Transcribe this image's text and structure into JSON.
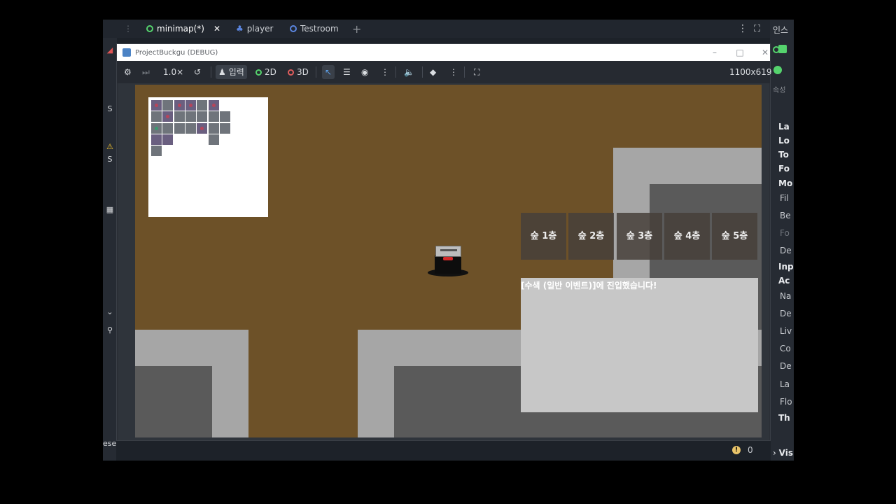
{
  "editor_tabs": [
    {
      "label": "minimap(*)",
      "icon": "scene-ring-icon",
      "close": "✕"
    },
    {
      "label": "player",
      "icon": "player-node-icon"
    },
    {
      "label": "Testroom",
      "icon": "scene-ring-icon"
    }
  ],
  "add_tab_label": "+",
  "right_panel": {
    "top_label": "인스",
    "sub_label": "속성",
    "items": [
      "La",
      "Lo",
      "To",
      "Fo",
      "Mo",
      "Fil",
      "Be",
      "Fo",
      "De",
      "Inp",
      "Ac",
      "Na",
      "De",
      "Liv",
      "Co",
      "De",
      "La",
      "Flo",
      "Th"
    ],
    "bottom_label": "Vis"
  },
  "left_strip": {
    "bottom_label": "ese"
  },
  "window": {
    "title": "ProjectBuckgu (DEBUG)",
    "minimize": "–",
    "maximize": "□",
    "close": "✕"
  },
  "toolbar": {
    "zoom": "1.0×",
    "input_label": "입력",
    "mode_2d": "2D",
    "mode_3d": "3D",
    "resolution": "1100x619"
  },
  "floors": [
    "숲 1층",
    "숲 2층",
    "숲 3층",
    "숲 4층",
    "숲 5층"
  ],
  "message": "[수색 (일반 이벤트)]에 진입했습니다!",
  "status": {
    "warning_count": "0"
  },
  "colors": {
    "ground": "#6d5128",
    "wall_light": "#a6a6a6",
    "wall_dark": "#5a5a5a",
    "minimap_bg": "#ffffff",
    "accent": "#55d36d"
  }
}
